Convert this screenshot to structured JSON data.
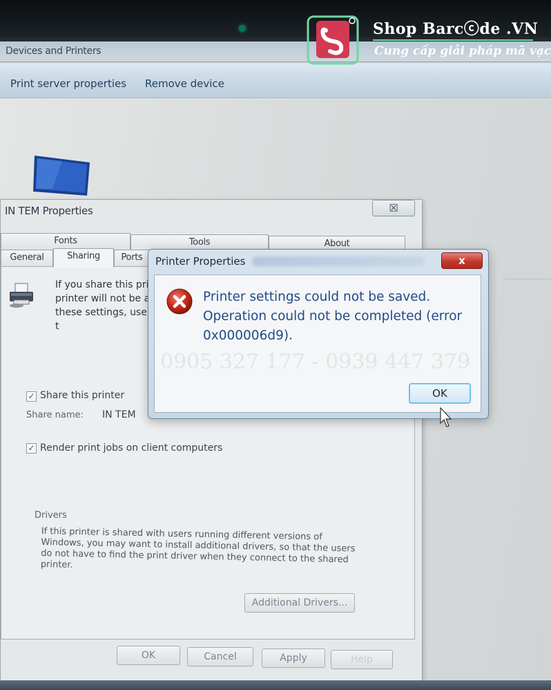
{
  "explorer": {
    "title": "Devices and Printers",
    "commands": {
      "print_server": "Print server properties",
      "remove_device": "Remove device"
    }
  },
  "properties_dialog": {
    "title": "IN TEM Properties",
    "close_glyph": "☒",
    "tabs_back_row": [
      "Fonts",
      "Tools",
      "About"
    ],
    "tabs_front_row": [
      "General",
      "Sharing",
      "Ports"
    ],
    "share_text": "If you share this pri\nprinter will not be a\nthese settings, use t",
    "share_checkbox_label": "Share this printer",
    "share_name_label": "Share name:",
    "share_name_value": "IN TEM",
    "render_checkbox_label": "Render print jobs on client computers",
    "drivers_heading": "Drivers",
    "drivers_text": "If this printer is shared with users running different versions of Windows, you may want to install additional drivers, so that the users do not have to find the print driver when they connect to the shared printer.",
    "additional_drivers_button": "Additional Drivers...",
    "buttons": {
      "ok": "OK",
      "cancel": "Cancel",
      "apply": "Apply",
      "help": "Help"
    },
    "share_checked": true,
    "render_checked": true
  },
  "error_dialog": {
    "title": "Printer Properties",
    "close_glyph": "x",
    "message": "Printer settings could not be saved.\nOperation could not be completed (error 0x000006d9).",
    "ok_button": "OK",
    "icon": "error-x-icon",
    "watermark_text": "0905 327 177 - 0939 447 379"
  },
  "logo": {
    "name": "Shop Barcⓒde .VN",
    "tagline": "Cung cấp giải pháp mã vạch"
  },
  "colors": {
    "accent_blue": "#234a8c",
    "error_red": "#c4372b",
    "logo_green": "#6ed8a4"
  }
}
